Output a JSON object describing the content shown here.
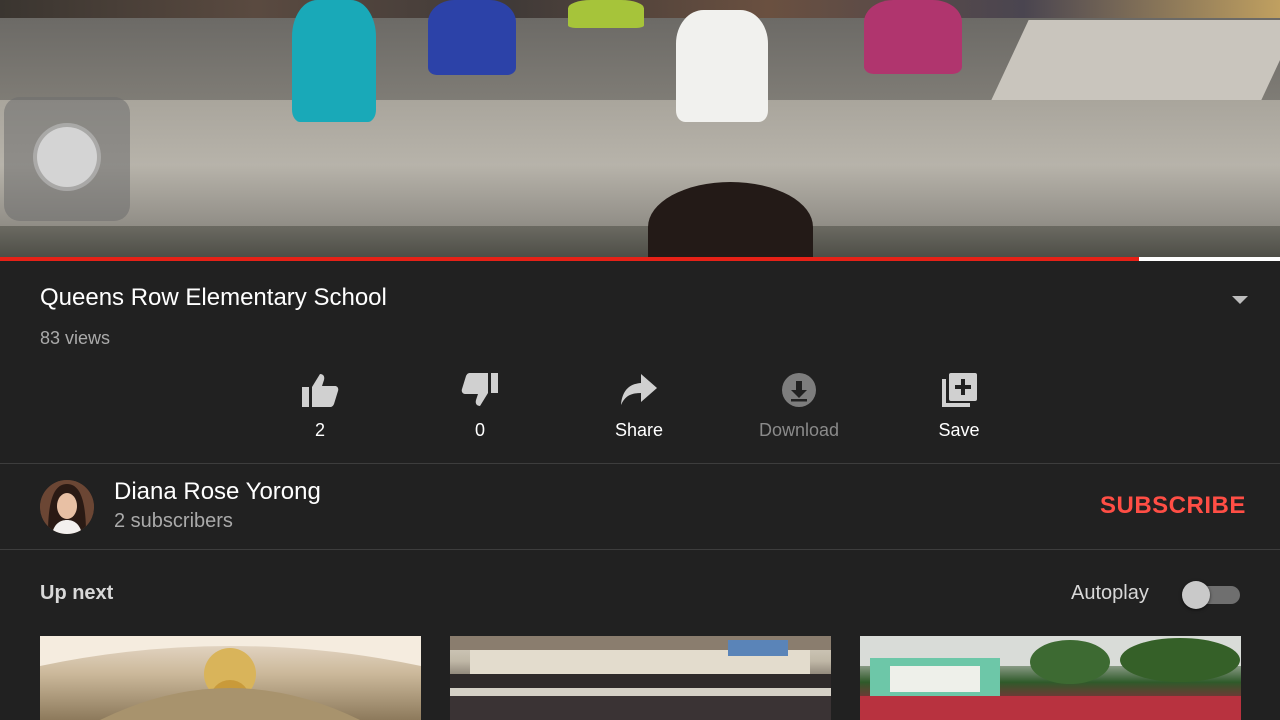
{
  "video": {
    "progress_fraction": 0.89
  },
  "title": "Queens Row Elementary School",
  "views": "83 views",
  "actions": {
    "like": "2",
    "dislike": "0",
    "share": "Share",
    "download": "Download",
    "save": "Save"
  },
  "channel": {
    "name": "Diana Rose Yorong",
    "subscribers": "2 subscribers",
    "subscribe_label": "SUBSCRIBE"
  },
  "up_next": {
    "heading": "Up next",
    "autoplay_label": "Autoplay",
    "autoplay_on": false
  },
  "colors": {
    "background": "#212121",
    "subscribe": "#ff4e45",
    "progress_played": "#e62117"
  }
}
